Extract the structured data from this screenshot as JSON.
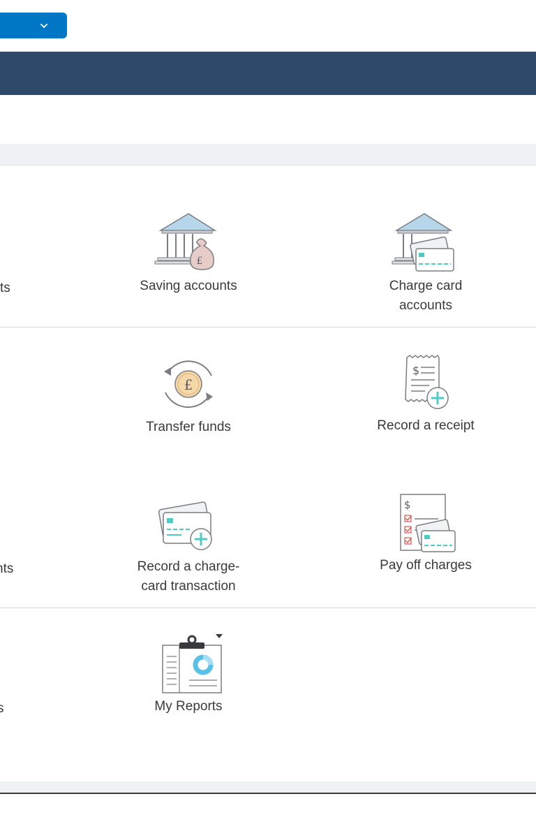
{
  "edge_labels": {
    "row1": "ts",
    "row3": "nts",
    "row4": "s"
  },
  "tiles": {
    "saving_accounts": "Saving accounts",
    "charge_card_accounts_l1": "Charge card",
    "charge_card_accounts_l2": "accounts",
    "transfer_funds": "Transfer funds",
    "record_receipt": "Record a receipt",
    "record_charge_l1": "Record a charge-",
    "record_charge_l2": "card transaction",
    "pay_off_charges": "Pay off charges",
    "my_reports": "My Reports"
  },
  "icons": {
    "dropdown": "chevron-down-icon",
    "saving": "bank-money-bag-icon",
    "charge_card": "bank-card-icon",
    "transfer": "transfer-pound-icon",
    "receipt": "receipt-add-icon",
    "charge_txn": "card-add-icon",
    "pay_off": "checklist-card-icon",
    "reports": "clipboard-report-icon"
  },
  "colors": {
    "accent": "#0077c5",
    "navbar": "#2e4a6b",
    "text": "#393a3d",
    "teal": "#4ecbc4"
  }
}
